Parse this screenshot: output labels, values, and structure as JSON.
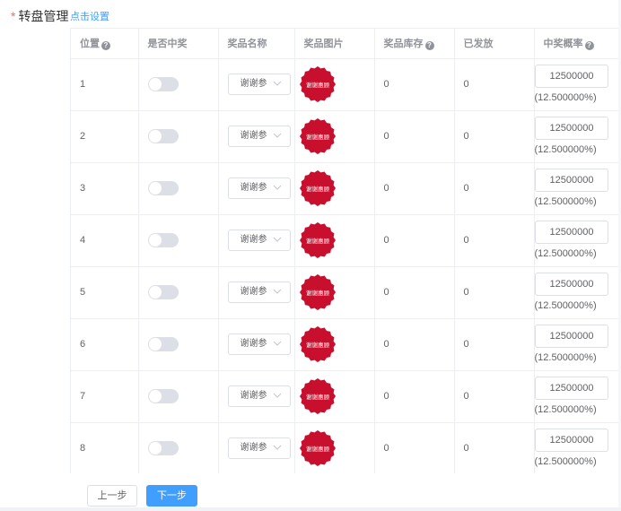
{
  "form": {
    "required_mark": "*",
    "label": "转盘管理",
    "setup_link": "点击设置"
  },
  "table": {
    "headers": {
      "position": "位置",
      "is_winning": "是否中奖",
      "prize_name": "奖品名称",
      "prize_image": "奖品图片",
      "stock": "奖品库存",
      "issued": "已发放",
      "rate": "中奖概率"
    },
    "help_glyph": "?",
    "rows": [
      {
        "position": "1",
        "prize_name": "谢谢参",
        "image_text": "谢谢惠顾",
        "stock": "0",
        "issued": "0",
        "rate_value": "12500000",
        "rate_percent": "(12.500000%)",
        "winning": false
      },
      {
        "position": "2",
        "prize_name": "谢谢参",
        "image_text": "谢谢惠顾",
        "stock": "0",
        "issued": "0",
        "rate_value": "12500000",
        "rate_percent": "(12.500000%)",
        "winning": false
      },
      {
        "position": "3",
        "prize_name": "谢谢参",
        "image_text": "谢谢惠顾",
        "stock": "0",
        "issued": "0",
        "rate_value": "12500000",
        "rate_percent": "(12.500000%)",
        "winning": false
      },
      {
        "position": "4",
        "prize_name": "谢谢参",
        "image_text": "谢谢惠顾",
        "stock": "0",
        "issued": "0",
        "rate_value": "12500000",
        "rate_percent": "(12.500000%)",
        "winning": false
      },
      {
        "position": "5",
        "prize_name": "谢谢参",
        "image_text": "谢谢惠顾",
        "stock": "0",
        "issued": "0",
        "rate_value": "12500000",
        "rate_percent": "(12.500000%)",
        "winning": false
      },
      {
        "position": "6",
        "prize_name": "谢谢参",
        "image_text": "谢谢惠顾",
        "stock": "0",
        "issued": "0",
        "rate_value": "12500000",
        "rate_percent": "(12.500000%)",
        "winning": false
      },
      {
        "position": "7",
        "prize_name": "谢谢参",
        "image_text": "谢谢惠顾",
        "stock": "0",
        "issued": "0",
        "rate_value": "12500000",
        "rate_percent": "(12.500000%)",
        "winning": false
      },
      {
        "position": "8",
        "prize_name": "谢谢参",
        "image_text": "谢谢惠顾",
        "stock": "0",
        "issued": "0",
        "rate_value": "12500000",
        "rate_percent": "(12.500000%)",
        "winning": false
      }
    ]
  },
  "buttons": {
    "prev": "上一步",
    "next": "下一步"
  },
  "colors": {
    "primary": "#409eff",
    "required": "#f56c6c",
    "badge": "#c8102e",
    "switch_off": "#dcdfe6"
  },
  "icons": {
    "help": "question-circle-icon",
    "dropdown": "chevron-down-icon",
    "switch": "toggle-switch-icon"
  }
}
